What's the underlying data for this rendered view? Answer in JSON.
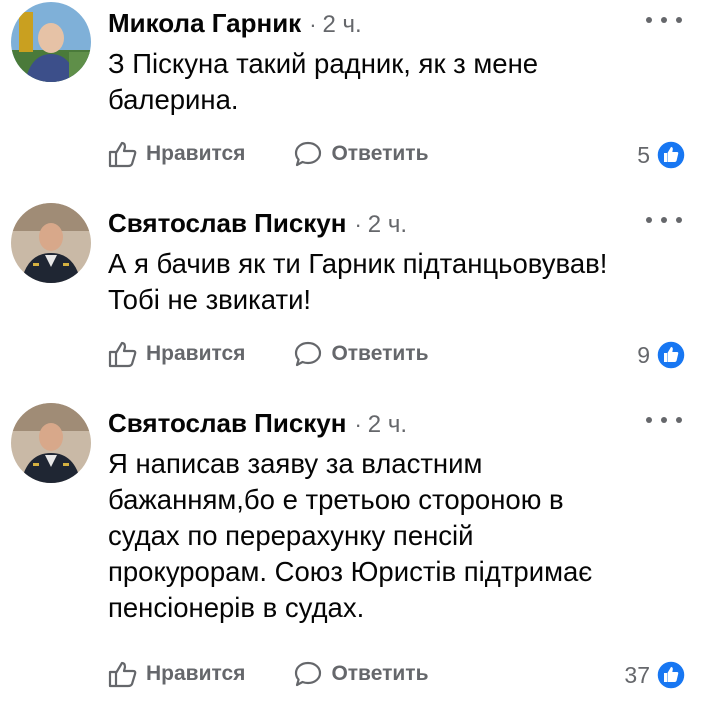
{
  "comments": [
    {
      "author": "Микола Гарник",
      "separator": "·",
      "time": "2 ч.",
      "text": "З Піскуна такий радник, як з мене\nбалерина.",
      "like_label": "Нравится",
      "reply_label": "Ответить",
      "reaction_count": "5"
    },
    {
      "author": "Святослав Пискун",
      "separator": "·",
      "time": "2 ч.",
      "text": "А я бачив як ти Гарник підтанцьовував!\nТобі не звикати!",
      "like_label": "Нравится",
      "reply_label": "Ответить",
      "reaction_count": "9"
    },
    {
      "author": "Святослав Пискун",
      "separator": "·",
      "time": "2 ч.",
      "text": "Я написав заяву за властним\nбажанням,бо е третьою стороною в\nсудах по перерахунку пенсій\nпрокурорам. Союз Юристів підтримає\nпенсіонерів в судах.",
      "like_label": "Нравится",
      "reply_label": "Ответить",
      "reaction_count": "37"
    }
  ],
  "colors": {
    "secondary_text": "#65676b",
    "primary_text": "#050505",
    "like_blue": "#1877f2"
  },
  "icons": [
    "more-options-icon",
    "thumbs-up-icon",
    "speech-bubble-icon",
    "like-reaction-icon"
  ]
}
